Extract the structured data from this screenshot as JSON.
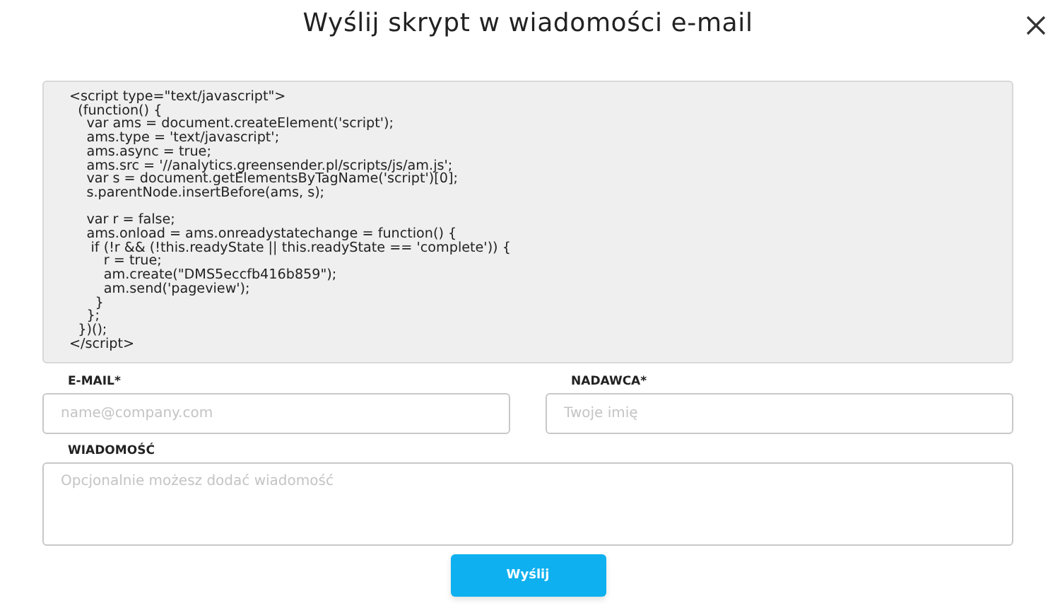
{
  "dialog": {
    "title": "Wyślij skrypt w wiadomości e-mail"
  },
  "code": "<script type=\"text/javascript\">\n  (function() {\n    var ams = document.createElement('script');\n    ams.type = 'text/javascript';\n    ams.async = true;\n    ams.src = '//analytics.greensender.pl/scripts/js/am.js';\n    var s = document.getElementsByTagName('script')[0];\n    s.parentNode.insertBefore(ams, s);\n\n    var r = false;\n    ams.onload = ams.onreadystatechange = function() {\n     if (!r && (!this.readyState || this.readyState == 'complete')) {\n        r = true;\n        am.create(\"DMS5eccfb416b859\");\n        am.send('pageview');\n      }\n    };\n  })();\n</script>",
  "fields": [
    {
      "label": "E-MAIL*",
      "placeholder": "name@company.com"
    },
    {
      "label": "NADAWCA*",
      "placeholder": "Twoje imię"
    }
  ],
  "message": {
    "label": "WIADOMOŚĆ",
    "placeholder": "Opcjonalnie możesz dodać wiadomość"
  },
  "submit": "Wyślij"
}
